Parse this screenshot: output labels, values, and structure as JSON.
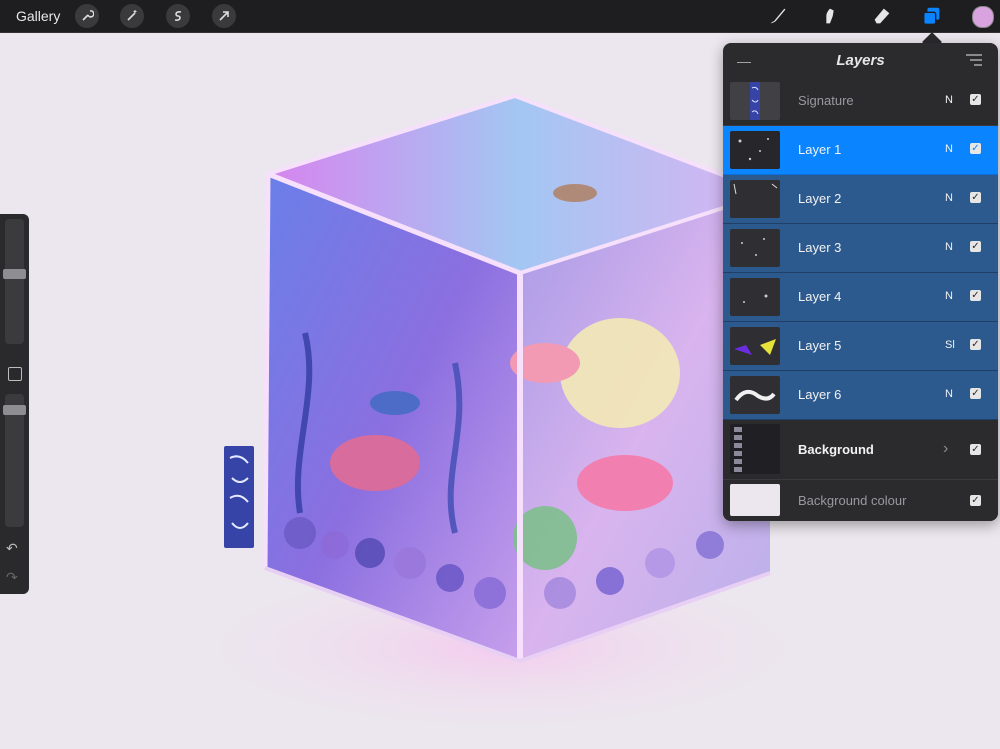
{
  "topbar": {
    "gallery_label": "Gallery",
    "left_icons": [
      "wrench-icon",
      "magic-wand-icon",
      "selection-s-icon",
      "transform-arrow-icon"
    ],
    "right_tools": [
      "brush-icon",
      "smudge-icon",
      "eraser-icon",
      "layers-icon"
    ],
    "active_tool": "layers-icon",
    "current_color": "#d9a3e0"
  },
  "layers_panel": {
    "title": "Layers",
    "layers": [
      {
        "name": "Signature",
        "mode": "N",
        "visible": true,
        "state": "normal"
      },
      {
        "name": "Layer 1",
        "mode": "N",
        "visible": true,
        "state": "active"
      },
      {
        "name": "Layer 2",
        "mode": "N",
        "visible": true,
        "state": "selected"
      },
      {
        "name": "Layer 3",
        "mode": "N",
        "visible": true,
        "state": "selected"
      },
      {
        "name": "Layer 4",
        "mode": "N",
        "visible": true,
        "state": "selected"
      },
      {
        "name": "Layer 5",
        "mode": "Sl",
        "visible": true,
        "state": "selected"
      },
      {
        "name": "Layer 6",
        "mode": "N",
        "visible": true,
        "state": "selected"
      }
    ],
    "background_group": {
      "name": "Background",
      "visible": true
    },
    "background_colour": {
      "name": "Background colour",
      "visible": true,
      "color": "#ece6ee"
    }
  },
  "colors": {
    "active_blue": "#0a84ff",
    "selected_blue": "#2c5a8e",
    "panel_bg": "#2b2b2e",
    "topbar_bg": "#1e1e20"
  },
  "sidebar": {
    "size_slider": 0.18,
    "opacity_slider": 0.1,
    "buttons": [
      "modify-square-icon",
      "undo-icon",
      "redo-icon"
    ]
  }
}
